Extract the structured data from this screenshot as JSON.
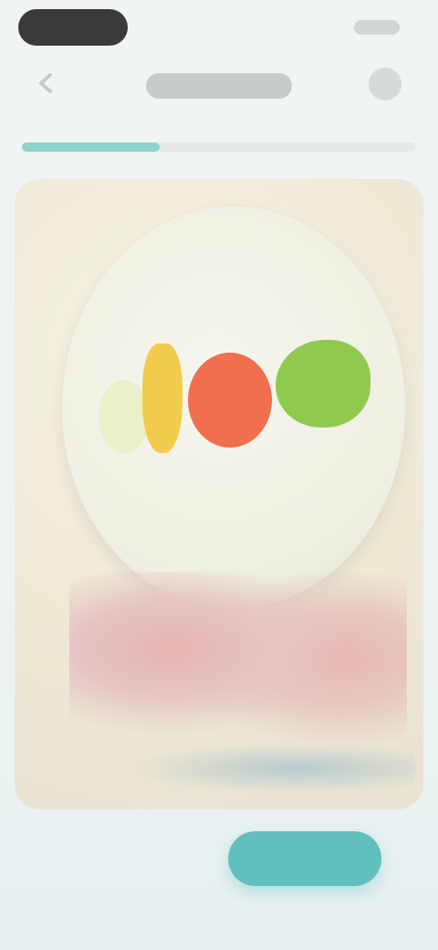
{
  "colors": {
    "accent": "#61bfbd",
    "progress": "#8fd3cf"
  },
  "header": {
    "title": "",
    "back_icon": "chevron-left-icon",
    "menu_icon": "more-icon"
  },
  "progress": {
    "fraction": 0.35
  },
  "card": {
    "caption": ""
  },
  "actions": {
    "secondary_label": "",
    "primary_label": ""
  }
}
